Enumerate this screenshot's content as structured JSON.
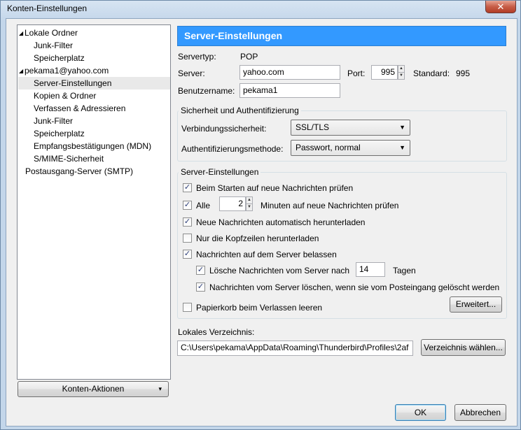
{
  "window": {
    "title": "Konten-Einstellungen",
    "close_label": "✕"
  },
  "sidebar": {
    "items": [
      {
        "label": "Lokale Ordner",
        "expander": "◢"
      },
      {
        "label": "Junk-Filter"
      },
      {
        "label": "Speicherplatz"
      },
      {
        "label": "pekama1@yahoo.com",
        "expander": "◢"
      },
      {
        "label": "Server-Einstellungen",
        "selected": true
      },
      {
        "label": "Kopien & Ordner"
      },
      {
        "label": "Verfassen & Adressieren"
      },
      {
        "label": "Junk-Filter"
      },
      {
        "label": "Speicherplatz"
      },
      {
        "label": "Empfangsbestätigungen (MDN)"
      },
      {
        "label": "S/MIME-Sicherheit"
      },
      {
        "label": "Postausgang-Server (SMTP)"
      }
    ],
    "actions_button": "Konten-Aktionen",
    "actions_arrow": "▾"
  },
  "panel": {
    "header": "Server-Einstellungen",
    "server_type_label": "Servertyp:",
    "server_type_value": "POP",
    "server_label": "Server:",
    "server_value": "yahoo.com",
    "port_label": "Port:",
    "port_value": "995",
    "standard_label": "Standard:",
    "standard_value": "995",
    "username_label": "Benutzername:",
    "username_value": "pekama1"
  },
  "security": {
    "title": "Sicherheit und Authentifizierung",
    "connection_label": "Verbindungssicherheit:",
    "connection_value": "SSL/TLS",
    "auth_label": "Authentifizierungsmethode:",
    "auth_value": "Passwort, normal"
  },
  "server_settings": {
    "title": "Server-Einstellungen",
    "check_on_start": {
      "label": "Beim Starten auf neue Nachrichten prüfen",
      "checked": true
    },
    "check_every": {
      "label": "Alle",
      "checked": true,
      "value": "2",
      "suffix": "Minuten auf neue Nachrichten prüfen"
    },
    "auto_download": {
      "label": "Neue Nachrichten automatisch herunterladen",
      "checked": true
    },
    "headers_only": {
      "label": "Nur die Kopfzeilen herunterladen",
      "checked": false
    },
    "leave_on_server": {
      "label": "Nachrichten auf dem Server belassen",
      "checked": true
    },
    "delete_after": {
      "label": "Lösche Nachrichten vom Server nach",
      "checked": true,
      "value": "14",
      "suffix": "Tagen"
    },
    "delete_when_deleted": {
      "label": "Nachrichten vom Server löschen, wenn sie vom Posteingang gelöscht werden",
      "checked": true
    },
    "empty_trash": {
      "label": "Papierkorb beim Verlassen leeren",
      "checked": false
    },
    "advanced_button": "Erweitert..."
  },
  "local_dir": {
    "label": "Lokales Verzeichnis:",
    "value": "C:\\Users\\pekama\\AppData\\Roaming\\Thunderbird\\Profiles\\2af",
    "browse_button": "Verzeichnis wählen..."
  },
  "footer": {
    "ok_button": "OK",
    "cancel_button": "Abbrechen"
  },
  "icons": {
    "check": "✓",
    "spin_up": "▲",
    "spin_down": "▼",
    "dropdown": "▼"
  }
}
